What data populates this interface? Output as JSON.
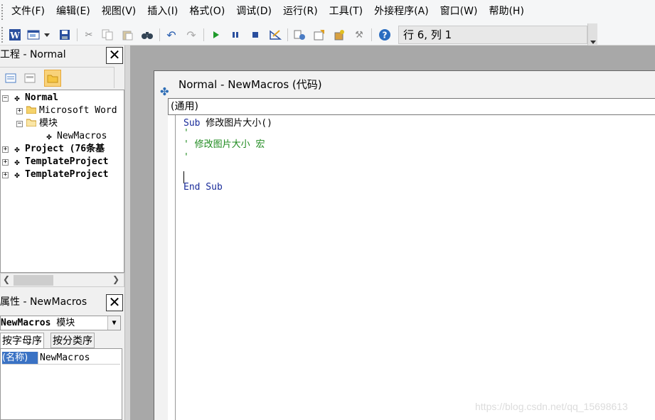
{
  "menubar": {
    "items": [
      "文件(F)",
      "编辑(E)",
      "视图(V)",
      "插入(I)",
      "格式(O)",
      "调试(D)",
      "运行(R)",
      "工具(T)",
      "外接程序(A)",
      "窗口(W)",
      "帮助(H)"
    ]
  },
  "toolbar": {
    "icons": [
      "word-icon",
      "insert-userform-icon",
      "dropdown-arrow-icon",
      "save-icon",
      "cut-icon",
      "copy-icon",
      "paste-icon",
      "find-icon",
      "undo-icon",
      "redo-icon",
      "run-icon",
      "break-icon",
      "reset-icon",
      "design-mode-icon",
      "project-explorer-icon",
      "properties-window-icon",
      "object-browser-icon",
      "toolbox-icon",
      "help-icon"
    ],
    "status": "行 6, 列 1"
  },
  "project_pane": {
    "title": "工程 - Normal",
    "tree": [
      {
        "label": "Normal",
        "bold": true
      },
      {
        "label": "Microsoft Word"
      },
      {
        "label": "模块"
      },
      {
        "label": "NewMacros"
      },
      {
        "label": "Project (76条基",
        "bold": true
      },
      {
        "label": "TemplateProject",
        "bold": true
      },
      {
        "label": "TemplateProject",
        "bold": true
      }
    ]
  },
  "properties_pane": {
    "title": "属性 - NewMacros",
    "object_name": "NewMacros",
    "object_type": "模块",
    "tabs": [
      "按字母序",
      "按分类序"
    ],
    "rows": [
      {
        "name": "(名称)",
        "value": "NewMacros"
      }
    ]
  },
  "code_window": {
    "title": "Normal - NewMacros (代码)",
    "object_combo": "(通用)",
    "lines": [
      {
        "kw": "Sub",
        "text": " 修改图片大小()"
      },
      {
        "cm": "'"
      },
      {
        "cm": "' 修改图片大小 宏"
      },
      {
        "cm": "'"
      },
      {
        "text": ""
      },
      {
        "kw": "End Sub",
        "text": ""
      }
    ]
  },
  "watermark": "https://blog.csdn.net/qq_15698613",
  "colors": {
    "keyword": "#1a2c9a",
    "comment": "#1e8a1e",
    "selection": "#3a72c4"
  }
}
